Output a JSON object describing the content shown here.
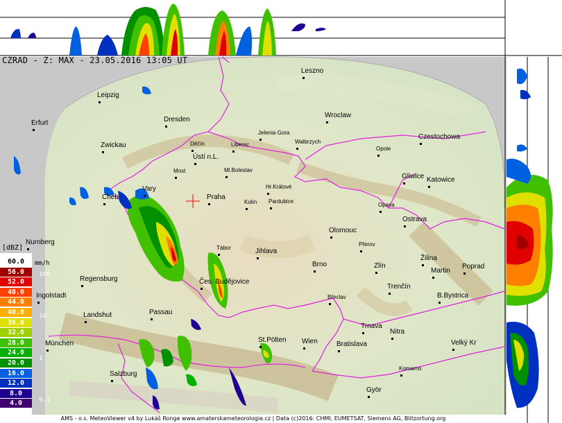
{
  "map_title": "CZRAD - Z: MAX - 23.05.2016 13:05 UT",
  "credit": "AMS - o.s. MeteoViewer v4 by Lukáš Ronge www.amaterskameteorologie.cz | Data (c)2016: CHMI, EUMETSAT, Siemens AG, Blitzortung.org",
  "legend": {
    "unit": "[dBZ]",
    "rain_unit": "mm/h",
    "levels": [
      {
        "label": "60.0",
        "color": "#ffffff",
        "text_color": "#000000"
      },
      {
        "label": "56.0",
        "color": "#a00000",
        "text_color": "#ffffff"
      },
      {
        "label": "52.0",
        "color": "#e00000",
        "text_color": "#ffffff"
      },
      {
        "label": "48.0",
        "color": "#ff4000",
        "text_color": "#ffffff"
      },
      {
        "label": "44.0",
        "color": "#ff8000",
        "text_color": "#ffffff"
      },
      {
        "label": "40.0",
        "color": "#ffb000",
        "text_color": "#ffffff"
      },
      {
        "label": "36.0",
        "color": "#e0e000",
        "text_color": "#ffffff"
      },
      {
        "label": "32.0",
        "color": "#a0d000",
        "text_color": "#ffffff"
      },
      {
        "label": "28.0",
        "color": "#40c000",
        "text_color": "#ffffff"
      },
      {
        "label": "24.0",
        "color": "#00b000",
        "text_color": "#ffffff"
      },
      {
        "label": "20.0",
        "color": "#009000",
        "text_color": "#ffffff"
      },
      {
        "label": "16.0",
        "color": "#0060e0",
        "text_color": "#ffffff"
      },
      {
        "label": "12.0",
        "color": "#0030c0",
        "text_color": "#ffffff"
      },
      {
        "label": "8.0",
        "color": "#200090",
        "text_color": "#ffffff"
      },
      {
        "label": "4.0",
        "color": "#400070",
        "text_color": "#ffffff"
      }
    ],
    "rain_rates": [
      "100",
      "10",
      "1",
      "0.1"
    ]
  },
  "cities": [
    {
      "name": "Leszno"
    },
    {
      "name": "Leipzig"
    },
    {
      "name": "Dresden"
    },
    {
      "name": "Wroclaw"
    },
    {
      "name": "Erfurt"
    },
    {
      "name": "Jelenia Gora"
    },
    {
      "name": "Czestochowa"
    },
    {
      "name": "Zwickau"
    },
    {
      "name": "Děčín"
    },
    {
      "name": "Liberec"
    },
    {
      "name": "Walbrzych"
    },
    {
      "name": "Opole"
    },
    {
      "name": "Ústí n.L."
    },
    {
      "name": "Gliwice"
    },
    {
      "name": "Katowice"
    },
    {
      "name": "Most"
    },
    {
      "name": "Ml.Boleslav"
    },
    {
      "name": "Hr.Králové"
    },
    {
      "name": "Cheb"
    },
    {
      "name": "Vary"
    },
    {
      "name": "Praha"
    },
    {
      "name": "Kolín"
    },
    {
      "name": "Pardubice"
    },
    {
      "name": "Opava"
    },
    {
      "name": "Ostrava"
    },
    {
      "name": "Olomouc"
    },
    {
      "name": "Přerov"
    },
    {
      "name": "Nurnberg"
    },
    {
      "name": "Tábor"
    },
    {
      "name": "Jihlava"
    },
    {
      "name": "Žilina"
    },
    {
      "name": "Brno"
    },
    {
      "name": "Zlín"
    },
    {
      "name": "Martin"
    },
    {
      "name": "Poprad"
    },
    {
      "name": "Regensburg"
    },
    {
      "name": "Čes. Budějovice"
    },
    {
      "name": "Trenčín"
    },
    {
      "name": "Ingolstadt"
    },
    {
      "name": "Břeclav"
    },
    {
      "name": "B.Bystrica"
    },
    {
      "name": "Landshut"
    },
    {
      "name": "Passau"
    },
    {
      "name": "Trnava"
    },
    {
      "name": "Nitra"
    },
    {
      "name": "München"
    },
    {
      "name": "St.Pölten"
    },
    {
      "name": "Wien"
    },
    {
      "name": "Bratislava"
    },
    {
      "name": "Velký Kr"
    },
    {
      "name": "Salzburg"
    },
    {
      "name": "Komarno"
    },
    {
      "name": "Györ"
    }
  ]
}
